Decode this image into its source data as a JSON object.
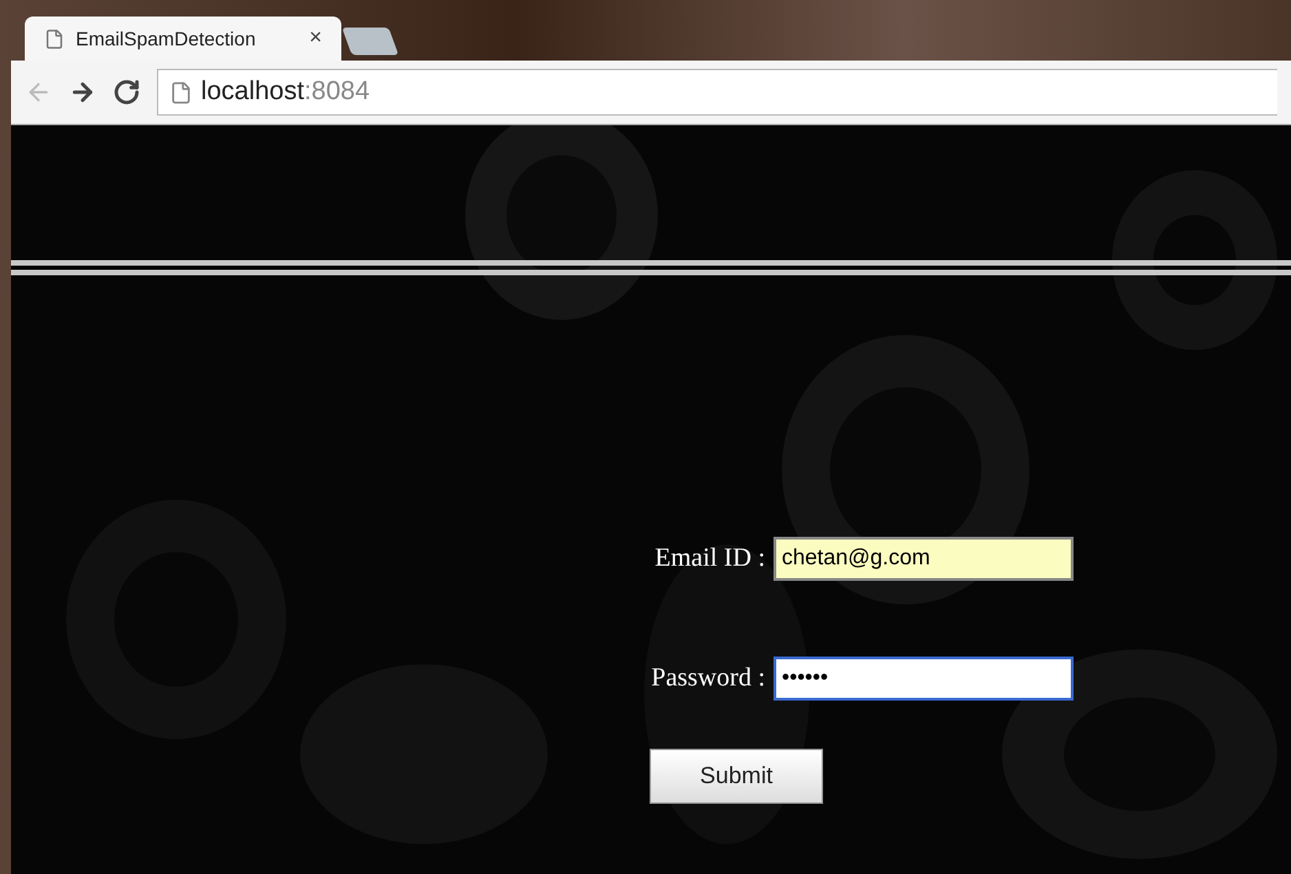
{
  "browser": {
    "tab": {
      "title": "EmailSpamDetection",
      "close": "×",
      "selected": true
    },
    "address": {
      "host": "localhost",
      "port": ":8084"
    }
  },
  "form": {
    "fields": [
      {
        "label": "Email ID :",
        "value": "chetan@g.com",
        "autofilled": true,
        "focused": false
      },
      {
        "label": "Password :",
        "value": "••••••",
        "autofilled": false,
        "focused": true
      }
    ],
    "submit": "Submit"
  }
}
